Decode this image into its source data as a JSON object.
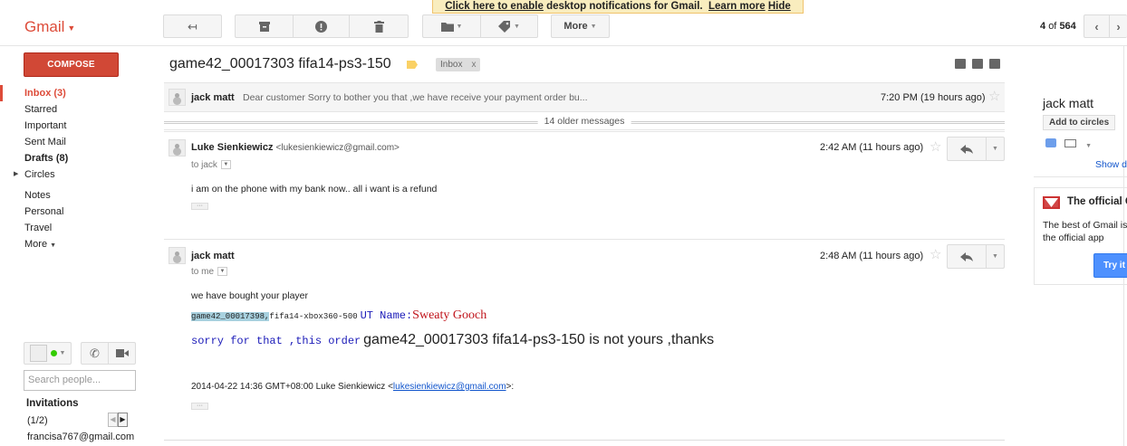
{
  "notification": {
    "link_text": "Click here to enable",
    "text": "desktop notifications for Gmail.",
    "learn_more": "Learn more",
    "hide": "Hide"
  },
  "app": {
    "logo": "Gmail"
  },
  "toolbar": {
    "more_label": "More",
    "pager_current": "4",
    "pager_of": "of",
    "pager_total": "564"
  },
  "nav": {
    "compose": "COMPOSE",
    "items": [
      {
        "label": "Inbox (3)"
      },
      {
        "label": "Starred"
      },
      {
        "label": "Important"
      },
      {
        "label": "Sent Mail"
      },
      {
        "label": "Drafts (8)"
      },
      {
        "label": "Circles"
      },
      {
        "label": "Notes"
      },
      {
        "label": "Personal"
      },
      {
        "label": "Travel"
      },
      {
        "label": "More"
      }
    ]
  },
  "chat": {
    "search_placeholder": "Search people...",
    "invitations_title": "Invitations",
    "invitations_count": "(1/2)",
    "invitation_email": "francisa767@gmail.com"
  },
  "thread": {
    "subject": "game42_00017303 fifa14-ps3-150",
    "label_chip": "Inbox",
    "label_chip_close": "x",
    "collapsed": {
      "sender": "jack matt",
      "snippet": "Dear customer Sorry to bother you that ,we have receive your payment order bu...",
      "time": "7:20 PM (19 hours ago)"
    },
    "older_messages": "14 older messages",
    "messages": [
      {
        "sender": "Luke Sienkiewicz",
        "email": "<lukesienkiewicz@gmail.com>",
        "to": "to jack",
        "time": "2:42 AM (11 hours ago)",
        "body": "i am on the phone with my bank now.. all i want is a refund"
      },
      {
        "sender": "jack matt",
        "to": "to me",
        "time": "2:48 AM (11 hours ago)",
        "line1": "we have bought your player",
        "line2_highlight": "game42_00017398,",
        "line2_rest": "fifa14-xbox360-500",
        "line2_ut": "UT Name:",
        "line2_name": "Sweaty Gooch",
        "line3_a": "sorry for that ,this order",
        "line3_b": "game42_00017303 fifa14-ps3-150 is not yours ,thanks",
        "quote_prefix": "2014-04-22 14:36 GMT+08:00 Luke Sienkiewicz <",
        "quote_link": "lukesienkiewicz@gmail.com",
        "quote_suffix": ">:"
      }
    ]
  },
  "right_panel": {
    "name": "jack matt",
    "add_to_circles": "Add to circles",
    "show_details": "Show d",
    "promo_title": "The official G",
    "promo_body_1": "The best of Gmail is",
    "promo_body_2": "the official app",
    "promo_button": "Try it N"
  },
  "icons": {
    "reply": "reply-icon",
    "archive": "archive-icon",
    "spam": "report-spam-icon",
    "delete": "trash-icon",
    "folder": "folder-icon",
    "label": "label-icon",
    "star": "star-icon"
  },
  "colors": {
    "brand_red": "#dd4b39",
    "compose_red": "#d14836",
    "link_blue": "#1155cc",
    "notification_bg": "#f9edbe",
    "highlight": "#a8d1df"
  }
}
